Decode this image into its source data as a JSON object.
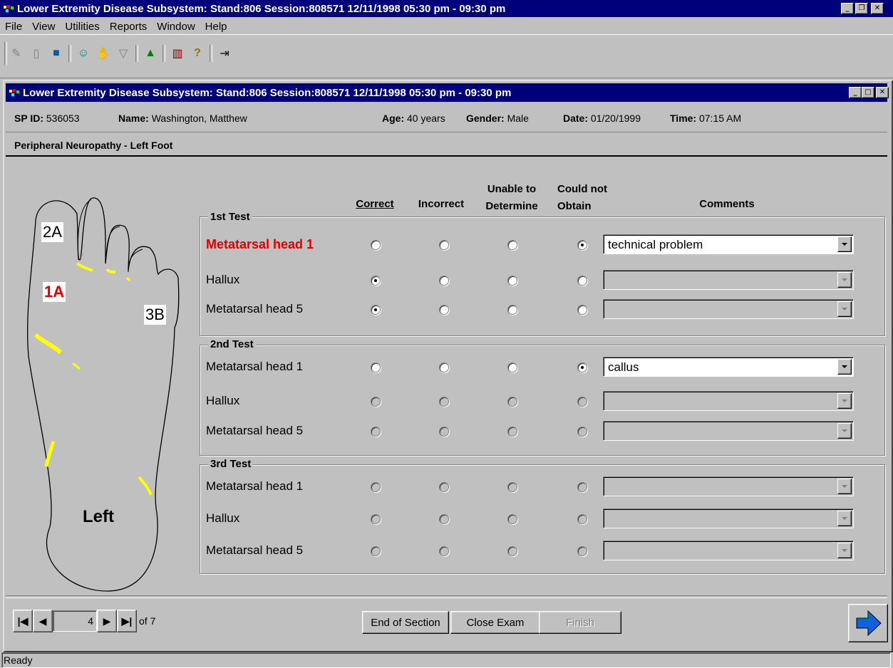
{
  "app": {
    "title": "Lower Extremity Disease Subsystem: Stand:806 Session:808571 12/11/1998 05:30 pm - 09:30 pm",
    "menu": [
      "File",
      "View",
      "Utilities",
      "Reports",
      "Window",
      "Help"
    ]
  },
  "child": {
    "title": "Lower Extremity Disease Subsystem: Stand:806 Session:808571 12/11/1998 05:30 pm - 09:30 pm"
  },
  "patient": {
    "sp_id_label": "SP ID:",
    "sp_id": "536053",
    "name_label": "Name:",
    "name": "Washington, Matthew",
    "age_label": "Age:",
    "age": "40 years",
    "gender_label": "Gender:",
    "gender": "Male",
    "date_label": "Date:",
    "date": "01/20/1999",
    "time_label": "Time:",
    "time": "07:15 AM"
  },
  "section_title": "Peripheral Neuropathy - Left Foot",
  "foot": {
    "label_2a": "2A",
    "label_1a": "1A",
    "label_3b": "3B",
    "side": "Left"
  },
  "columns": {
    "correct": "Correct",
    "incorrect": "Incorrect",
    "unable_1": "Unable to",
    "unable_2": "Determine",
    "couldnot_1": "Could not",
    "couldnot_2": "Obtain",
    "comments": "Comments"
  },
  "tests": [
    {
      "title": "1st Test",
      "rows": [
        {
          "label": "Metatarsal head 1",
          "selected": 3,
          "comment": "technical problem"
        },
        {
          "label": "Hallux",
          "selected": 0,
          "comment": ""
        },
        {
          "label": "Metatarsal head 5",
          "selected": 0,
          "comment": ""
        }
      ]
    },
    {
      "title": "2nd Test",
      "rows": [
        {
          "label": "Metatarsal head 1",
          "selected": 3,
          "comment": "callus"
        },
        {
          "label": "Hallux",
          "selected": -1,
          "comment": ""
        },
        {
          "label": "Metatarsal head 5",
          "selected": -1,
          "comment": ""
        }
      ]
    },
    {
      "title": "3rd Test",
      "rows": [
        {
          "label": "Metatarsal head 1",
          "selected": -1,
          "comment": ""
        },
        {
          "label": "Hallux",
          "selected": -1,
          "comment": ""
        },
        {
          "label": "Metatarsal head 5",
          "selected": -1,
          "comment": ""
        }
      ]
    }
  ],
  "nav": {
    "page": "4",
    "of_label": "of 7",
    "end_section": "End of Section",
    "close_exam": "Close Exam",
    "finish": "Finish"
  },
  "status": "Ready",
  "colors": {
    "title_bg": "#00007b",
    "highlight": "#e00000",
    "foot_marks": "#ffff00"
  }
}
